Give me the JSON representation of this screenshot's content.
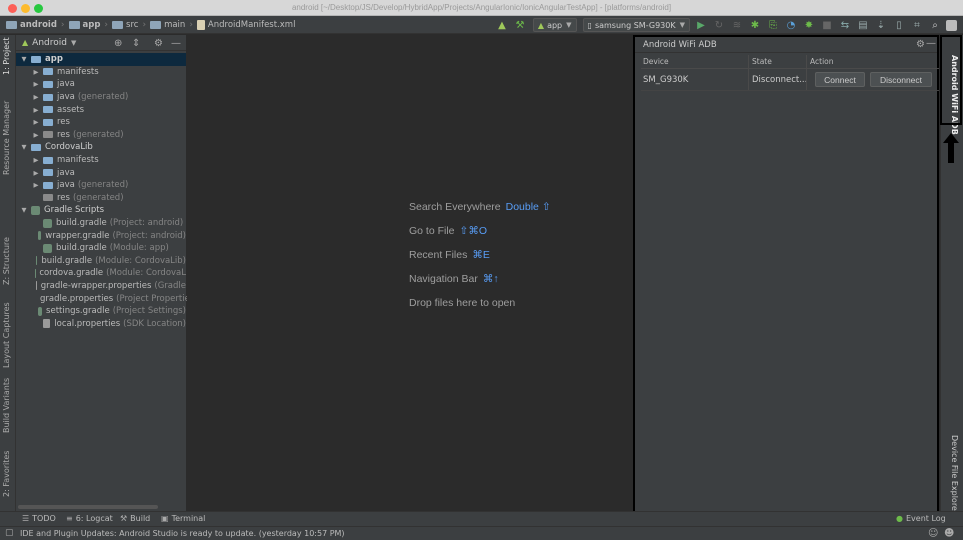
{
  "window": {
    "title": "android [~/Desktop/JS/Develop/HybridApp/Projects/AngularIonic/IonicAngularTestApp] - [platforms/android]"
  },
  "breadcrumb": [
    "android",
    "app",
    "src",
    "main",
    "AndroidManifest.xml"
  ],
  "toolbar": {
    "run_config": "app",
    "device": "samsung SM-G930K"
  },
  "left_strip": [
    "1: Project",
    "Resource Manager",
    "Z: Structure",
    "Layout Captures",
    "Build Variants",
    "2: Favorites"
  ],
  "right_strip": [
    "Android WiFi ADB",
    "Device File Explorer"
  ],
  "project": {
    "view_label": "Android",
    "tree": [
      {
        "label": "app",
        "hint": "",
        "level": 0,
        "arrow": "▼",
        "icon": "folder",
        "selected": true
      },
      {
        "label": "manifests",
        "hint": "",
        "level": 1,
        "arrow": "▶",
        "icon": "folder"
      },
      {
        "label": "java",
        "hint": "",
        "level": 1,
        "arrow": "▶",
        "icon": "folder"
      },
      {
        "label": "java",
        "hint": "(generated)",
        "level": 1,
        "arrow": "▶",
        "icon": "folder"
      },
      {
        "label": "assets",
        "hint": "",
        "level": 1,
        "arrow": "▶",
        "icon": "folder"
      },
      {
        "label": "res",
        "hint": "",
        "level": 1,
        "arrow": "▶",
        "icon": "folder"
      },
      {
        "label": "res",
        "hint": "(generated)",
        "level": 1,
        "arrow": "▶",
        "icon": "folder-gray"
      },
      {
        "label": "CordovaLib",
        "hint": "",
        "level": 0,
        "arrow": "▼",
        "icon": "folder"
      },
      {
        "label": "manifests",
        "hint": "",
        "level": 1,
        "arrow": "▶",
        "icon": "folder"
      },
      {
        "label": "java",
        "hint": "",
        "level": 1,
        "arrow": "▶",
        "icon": "folder"
      },
      {
        "label": "java",
        "hint": "(generated)",
        "level": 1,
        "arrow": "▶",
        "icon": "folder"
      },
      {
        "label": "res",
        "hint": "(generated)",
        "level": 1,
        "arrow": "",
        "icon": "folder-gray"
      },
      {
        "label": "Gradle Scripts",
        "hint": "",
        "level": 0,
        "arrow": "▼",
        "icon": "gradle"
      },
      {
        "label": "build.gradle",
        "hint": "(Project: android)",
        "level": 1,
        "arrow": "",
        "icon": "gradle"
      },
      {
        "label": "wrapper.gradle",
        "hint": "(Project: android)",
        "level": 1,
        "arrow": "",
        "icon": "gradle"
      },
      {
        "label": "build.gradle",
        "hint": "(Module: app)",
        "level": 1,
        "arrow": "",
        "icon": "gradle"
      },
      {
        "label": "build.gradle",
        "hint": "(Module: CordovaLib)",
        "level": 1,
        "arrow": "",
        "icon": "gradle"
      },
      {
        "label": "cordova.gradle",
        "hint": "(Module: CordovaL",
        "level": 1,
        "arrow": "",
        "icon": "gradle"
      },
      {
        "label": "gradle-wrapper.properties",
        "hint": "(Gradle",
        "level": 1,
        "arrow": "",
        "icon": "props"
      },
      {
        "label": "gradle.properties",
        "hint": "(Project Propertie",
        "level": 1,
        "arrow": "",
        "icon": "props"
      },
      {
        "label": "settings.gradle",
        "hint": "(Project Settings)",
        "level": 1,
        "arrow": "",
        "icon": "gradle"
      },
      {
        "label": "local.properties",
        "hint": "(SDK Location)",
        "level": 1,
        "arrow": "",
        "icon": "props"
      }
    ]
  },
  "editor_hints": [
    {
      "text": "Search Everywhere",
      "key": "Double ⇧"
    },
    {
      "text": "Go to File",
      "key": "⇧⌘O"
    },
    {
      "text": "Recent Files",
      "key": "⌘E"
    },
    {
      "text": "Navigation Bar",
      "key": "⌘↑"
    },
    {
      "text": "Drop files here to open",
      "key": ""
    }
  ],
  "adb_panel": {
    "title": "Android WiFi ADB",
    "columns": [
      "Device",
      "State",
      "Action"
    ],
    "rows": [
      {
        "device": "SM_G930K",
        "state": "Disconnect...",
        "connect_label": "Connect",
        "disconnect_label": "Disconnect"
      }
    ]
  },
  "tool_windows": [
    "TODO",
    "6: Logcat",
    "Build",
    "Terminal",
    "Event Log"
  ],
  "status": {
    "message": "IDE and Plugin Updates: Android Studio is ready to update. (yesterday 10:57 PM)"
  }
}
